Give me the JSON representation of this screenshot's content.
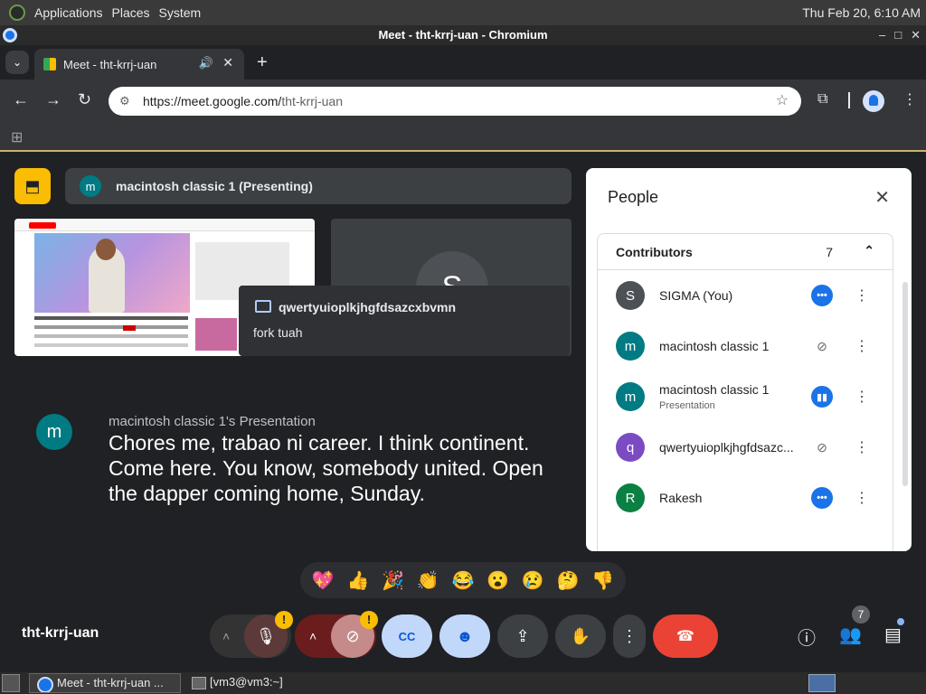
{
  "os": {
    "menu": [
      "Applications",
      "Places",
      "System"
    ],
    "clock": "Thu Feb 20,  6:10 AM"
  },
  "window": {
    "title": "Meet - tht-krrj-uan - Chromium"
  },
  "browser": {
    "tab_title": "Meet - tht-krrj-uan",
    "url_domain": "https://meet.google.com/",
    "url_path": "tht-krrj-uan"
  },
  "meet": {
    "presenting_label": "macintosh classic 1 (Presenting)",
    "presenter_initial": "m",
    "self_initial": "S",
    "toast": {
      "sender": "qwertyuioplkjhgfdsazcxbvmn",
      "message": "fork tuah"
    },
    "caption": {
      "speaker_initial": "m",
      "speaker": "macintosh classic 1's Presentation",
      "text": "Chores me, trabao ni career. I think continent. Come here. You know, somebody united. Open the dapper coming home, Sunday."
    },
    "reactions": [
      "💖",
      "👍",
      "🎉",
      "👏",
      "😂",
      "😮",
      "😢",
      "🤔",
      "👎"
    ],
    "meeting_code": "tht-krrj-uan",
    "people_count": "7"
  },
  "people_panel": {
    "title": "People",
    "section": "Contributors",
    "count": "7",
    "people": [
      {
        "initial": "S",
        "name": "SIGMA (You)",
        "sub": "",
        "color": "#4d5156",
        "status": "dots"
      },
      {
        "initial": "m",
        "name": "macintosh classic 1",
        "sub": "",
        "color": "#007b83",
        "status": "muted"
      },
      {
        "initial": "m",
        "name": "macintosh classic 1",
        "sub": "Presentation",
        "color": "#007b83",
        "status": "speak"
      },
      {
        "initial": "q",
        "name": "qwertyuioplkjhgfdsazc...",
        "sub": "",
        "color": "#7b4bc4",
        "status": "muted"
      },
      {
        "initial": "R",
        "name": "Rakesh",
        "sub": "",
        "color": "#0b8043",
        "status": "dots"
      }
    ]
  },
  "taskbar": {
    "items": [
      "Meet - tht-krrj-uan ...",
      "[vm3@vm3:~]"
    ]
  }
}
